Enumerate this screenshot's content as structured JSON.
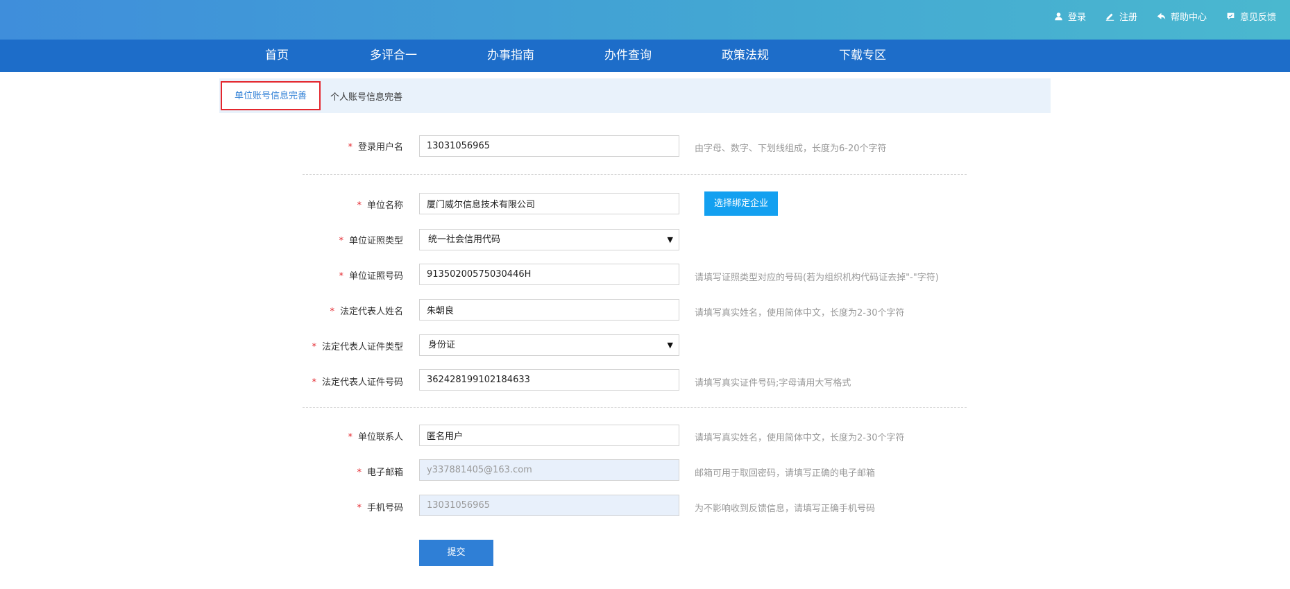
{
  "header": {
    "links": [
      {
        "label": "登录",
        "icon": "user-icon"
      },
      {
        "label": "注册",
        "icon": "pencil-icon"
      },
      {
        "label": "帮助中心",
        "icon": "help-arrow-icon"
      },
      {
        "label": "意见反馈",
        "icon": "feedback-icon"
      }
    ]
  },
  "nav": {
    "items": [
      "首页",
      "多评合一",
      "办事指南",
      "办件查询",
      "政策法规",
      "下载专区"
    ]
  },
  "tabs": {
    "active": "单位账号信息完善",
    "second": "个人账号信息完善"
  },
  "form": {
    "username": {
      "label": "登录用户名",
      "value": "13031056965",
      "hint": "由字母、数字、下划线组成，长度为6-20个字符"
    },
    "company_name": {
      "label": "单位名称",
      "value": "厦门威尔信息技术有限公司"
    },
    "bind_button": "选择绑定企业",
    "license_type": {
      "label": "单位证照类型",
      "value": "统一社会信用代码"
    },
    "license_no": {
      "label": "单位证照号码",
      "value": "91350200575030446H",
      "hint": "请填写证照类型对应的号码(若为组织机构代码证去掉\"-\"字符)"
    },
    "legal_name": {
      "label": "法定代表人姓名",
      "value": "朱朝良",
      "hint": "请填写真实姓名，使用简体中文，长度为2-30个字符"
    },
    "legal_id_type": {
      "label": "法定代表人证件类型",
      "value": "身份证"
    },
    "legal_id_no": {
      "label": "法定代表人证件号码",
      "value": "362428199102184633",
      "hint": "请填写真实证件号码;字母请用大写格式"
    },
    "contact": {
      "label": "单位联系人",
      "value": "匿名用户",
      "hint": "请填写真实姓名，使用简体中文，长度为2-30个字符"
    },
    "email": {
      "label": "电子邮箱",
      "value": "y337881405@163.com",
      "hint": "邮箱可用于取回密码，请填写正确的电子邮箱"
    },
    "mobile": {
      "label": "手机号码",
      "value": "13031056965",
      "hint": "为不影响收到反馈信息，请填写正确手机号码"
    },
    "required_mark": "*",
    "submit": "提交"
  },
  "colors": {
    "header_gradient_start": "#3f8edb",
    "header_gradient_end": "#4ab8cf",
    "nav_bg": "#1d6dc9",
    "tab_strip_bg": "#e9f2fb",
    "active_tab_border": "#e4262d",
    "bind_button_bg": "#13a0f0",
    "submit_bg": "#2f7fd6",
    "disabled_field_bg": "#e8f0fb"
  }
}
